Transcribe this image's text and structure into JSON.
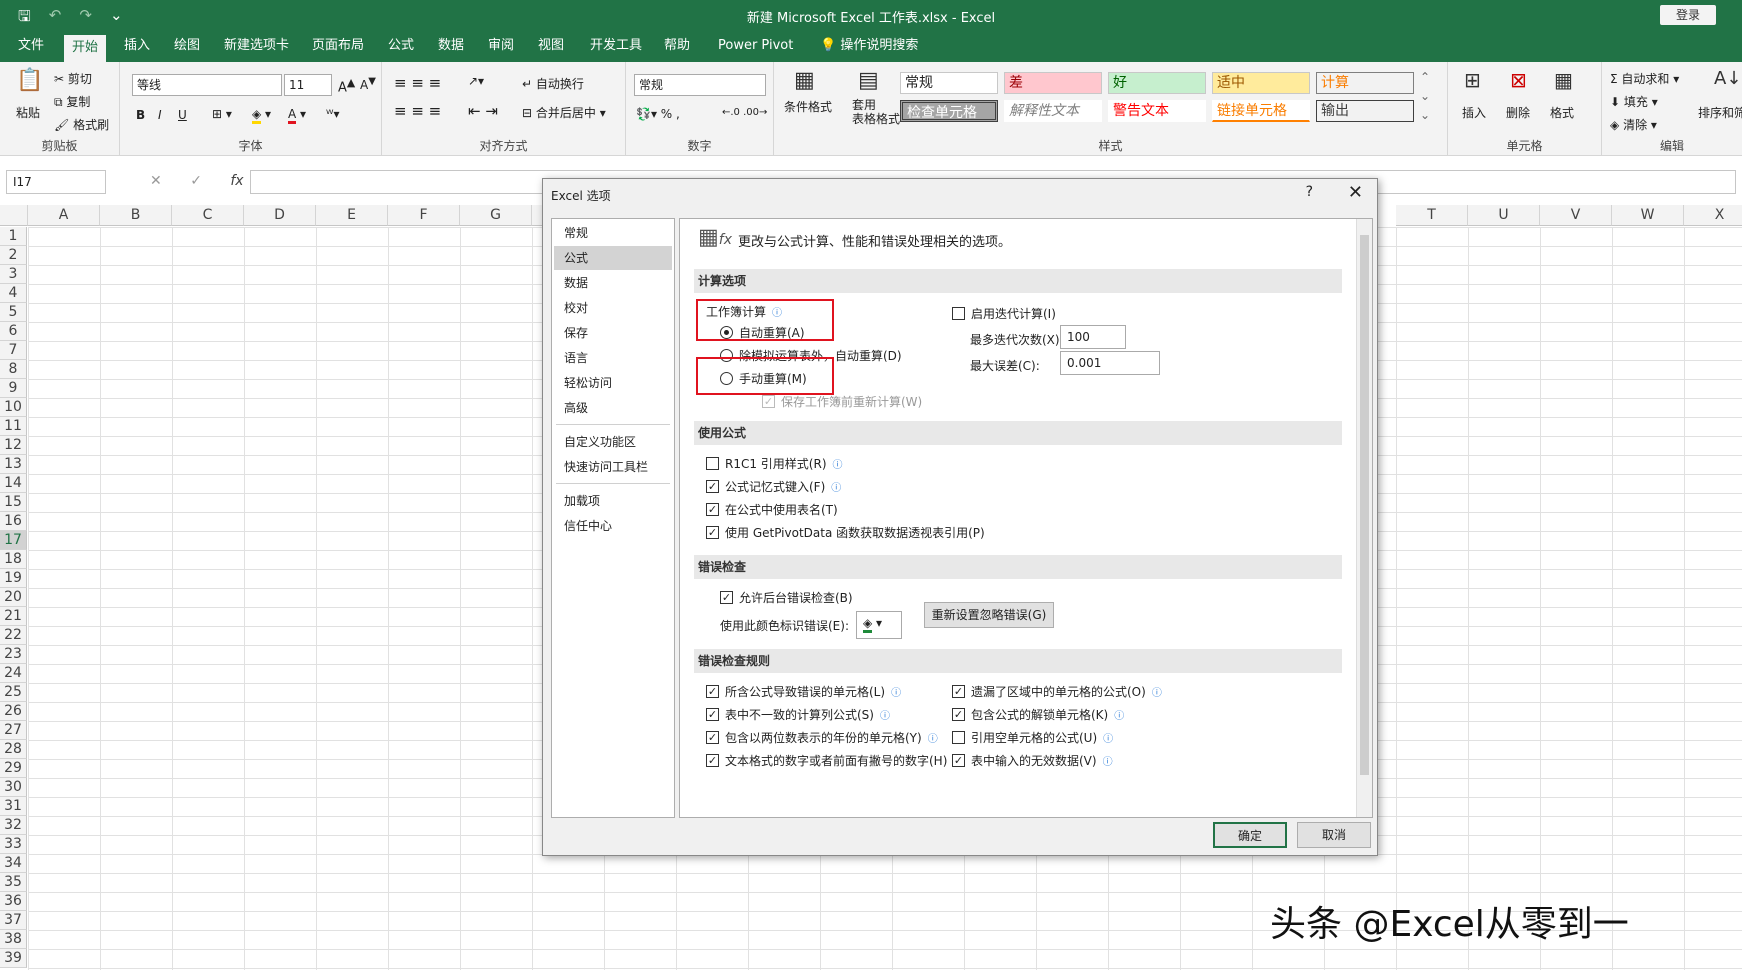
{
  "window": {
    "title": "新建 Microsoft Excel 工作表.xlsx  -  Excel",
    "signin": "登录",
    "qat": {
      "save": "🖫",
      "undo": "↶",
      "redo": "↷",
      "more": "⌄"
    }
  },
  "tabs": [
    "文件",
    "开始",
    "插入",
    "绘图",
    "新建选项卡",
    "页面布局",
    "公式",
    "数据",
    "审阅",
    "视图",
    "开发工具",
    "帮助",
    "Power Pivot",
    "操作说明搜索"
  ],
  "ribbon": {
    "clipboard": {
      "paste": "粘贴",
      "cut": "剪切",
      "copy": "复制",
      "format_painter": "格式刷",
      "label": "剪贴板"
    },
    "font": {
      "name": "等线",
      "size": "11",
      "bold": "B",
      "italic": "I",
      "underline": "U",
      "label": "字体"
    },
    "alignment": {
      "wrap": "自动换行",
      "merge": "合并后居中",
      "label": "对齐方式"
    },
    "number": {
      "format": "常规",
      "label": "数字"
    },
    "styles": {
      "cond_format": "条件格式",
      "table_format": "套用\n表格格式",
      "cells": [
        "常规",
        "差",
        "好",
        "适中",
        "计算",
        "检查单元格",
        "解释性文本",
        "警告文本",
        "链接单元格",
        "输出"
      ],
      "label": "样式"
    },
    "cells": {
      "insert": "插入",
      "delete": "删除",
      "format": "格式",
      "label": "单元格"
    },
    "editing": {
      "autosum": "自动求和",
      "fill": "填充",
      "clear": "清除",
      "sort": "排序和筛",
      "label": "编辑"
    }
  },
  "formula_bar": {
    "name_box": "I17",
    "cancel": "✕",
    "enter": "✓",
    "fx": "fx"
  },
  "columns": [
    "A",
    "B",
    "C",
    "D",
    "E",
    "F",
    "G",
    "T",
    "U",
    "V",
    "W",
    "X"
  ],
  "rows": [
    "1",
    "2",
    "3",
    "4",
    "5",
    "6",
    "7",
    "8",
    "9",
    "10",
    "11",
    "12",
    "13",
    "14",
    "15",
    "16",
    "17",
    "18",
    "19",
    "20",
    "21",
    "22",
    "23",
    "24",
    "25",
    "26",
    "27",
    "28",
    "29",
    "30",
    "31",
    "32",
    "33",
    "34",
    "35",
    "36",
    "37",
    "38",
    "39"
  ],
  "selected_row": "17",
  "dialog": {
    "title": "Excel 选项",
    "help": "?",
    "close": "✕",
    "nav": [
      "常规",
      "公式",
      "数据",
      "校对",
      "保存",
      "语言",
      "轻松访问",
      "高级",
      "自定义功能区",
      "快速访问工具栏",
      "加载项",
      "信任中心"
    ],
    "selected_nav": "公式",
    "header": "更改与公式计算、性能和错误处理相关的选项。",
    "sections": {
      "calc": "计算选项",
      "formulas": "使用公式",
      "errcheck": "错误检查",
      "rules": "错误检查规则"
    },
    "calc": {
      "workbook_calc": "工作簿计算",
      "auto": "自动重算(A)",
      "auto_except": "除模拟运算表外，自动重算(D)",
      "manual": "手动重算(M)",
      "recalc_before_save": "保存工作簿前重新计算(W)",
      "iterative": "启用迭代计算(I)",
      "max_iter_label": "最多迭代次数(X):",
      "max_iter": "100",
      "max_change_label": "最大误差(C):",
      "max_change": "0.001"
    },
    "formulas": [
      "R1C1 引用样式(R)",
      "公式记忆式键入(F)",
      "在公式中使用表名(T)",
      "使用 GetPivotData 函数获取数据透视表引用(P)"
    ],
    "errcheck": {
      "background": "允许后台错误检查(B)",
      "color_label": "使用此颜色标识错误(E):",
      "reset": "重新设置忽略错误(G)"
    },
    "rules_left": [
      "所含公式导致错误的单元格(L)",
      "表中不一致的计算列公式(S)",
      "包含以两位数表示的年份的单元格(Y)",
      "文本格式的数字或者前面有撇号的数字(H)"
    ],
    "rules_right": [
      "遗漏了区域中的单元格的公式(O)",
      "包含公式的解锁单元格(K)",
      "引用空单元格的公式(U)",
      "表中输入的无效数据(V)"
    ],
    "ok": "确定",
    "cancel": "取消"
  },
  "watermark": "头条 @Excel从零到一"
}
